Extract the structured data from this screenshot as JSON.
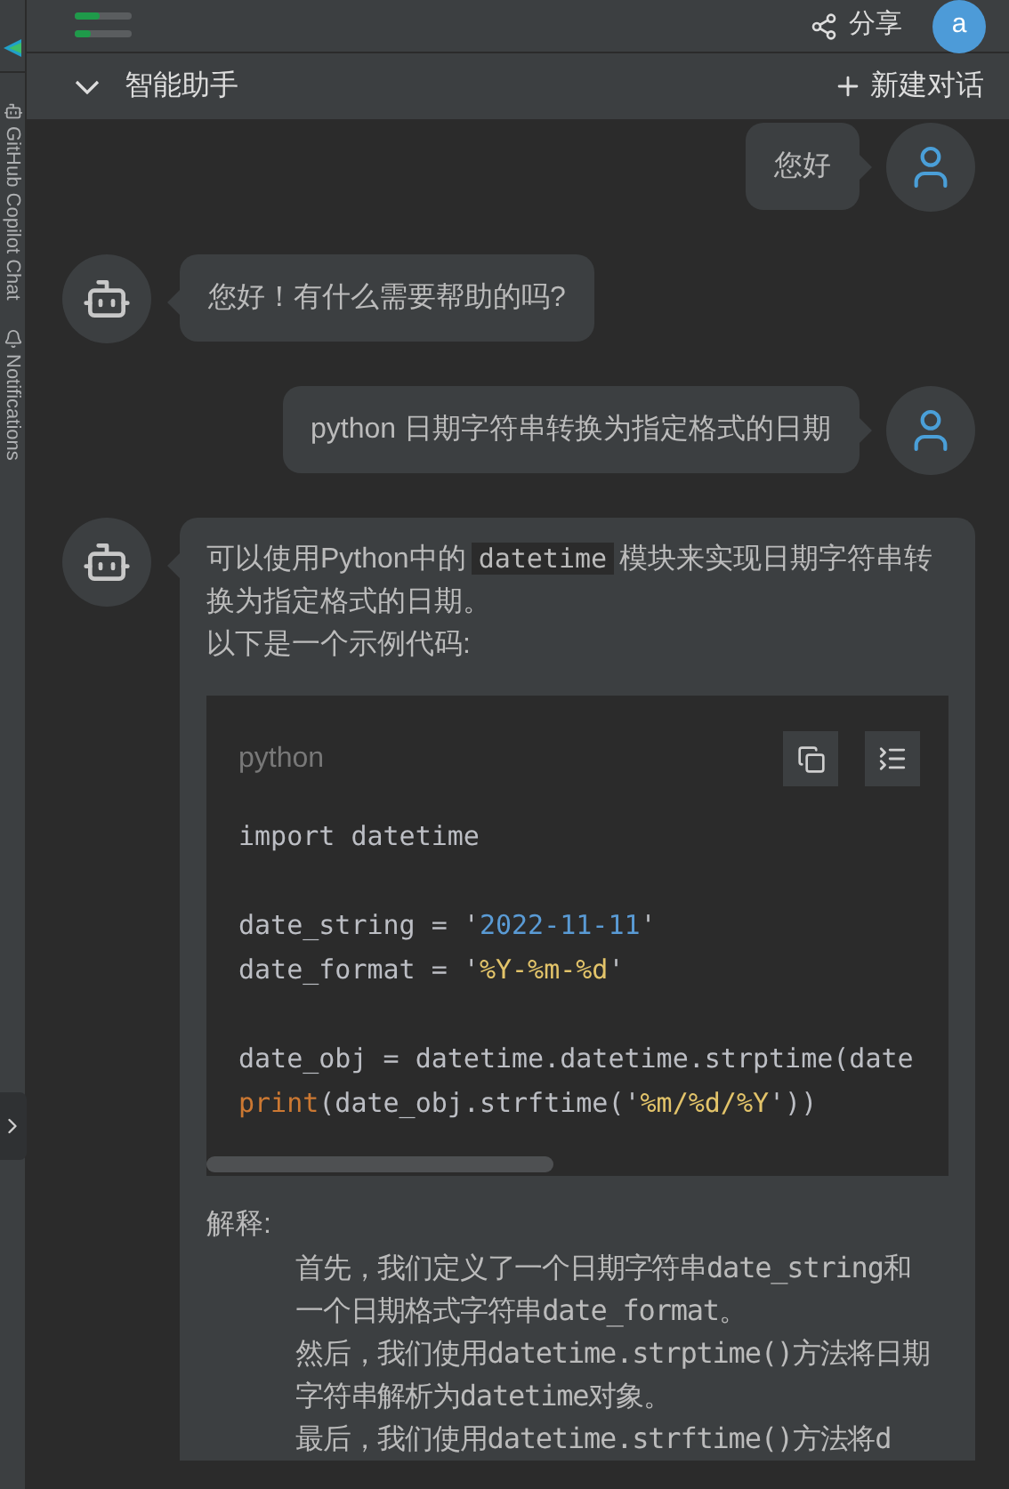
{
  "sidebar": {
    "tabs": [
      {
        "label": "GitHub Copilot Chat",
        "kind": "copilot"
      },
      {
        "label": "Notifications",
        "kind": "bell"
      }
    ]
  },
  "topbar": {
    "share": "分享",
    "avatar": "a"
  },
  "header": {
    "title": "智能助手",
    "expanded": true,
    "new_chat": "新建对话"
  },
  "messages": [
    {
      "kind": "user",
      "text": "您好"
    },
    {
      "kind": "bot",
      "text": "您好！有什么需要帮助的吗?"
    },
    {
      "kind": "user",
      "text": "python 日期字符串转换为指定格式的日期"
    },
    {
      "kind": "bot",
      "intro": [
        {
          "text": "可以使用Python中的",
          "code": false
        },
        {
          "text": "datetime",
          "code": true
        },
        {
          "text": "模块来实现日期字符串转换为指定格式的日期。",
          "code": false
        }
      ],
      "intro2": "以下是一个示例代码:",
      "code_block": {
        "language": "python",
        "groups": [
          [
            [
              {
                "text": "import datetime",
                "kind": "plain"
              }
            ]
          ],
          [
            [
              {
                "text": "date_string = '",
                "kind": "plain"
              },
              {
                "text": "2022-11-11",
                "kind": "number"
              },
              {
                "text": "'",
                "kind": "plain"
              }
            ],
            [
              {
                "text": "date_format = '",
                "kind": "plain"
              },
              {
                "text": "%Y-%m-%d",
                "kind": "format"
              },
              {
                "text": "'",
                "kind": "plain"
              }
            ]
          ],
          [
            [
              {
                "text": "date_obj = datetime.datetime.strptime(date",
                "kind": "plain"
              }
            ],
            [
              {
                "text": "print",
                "kind": "builtin"
              },
              {
                "text": "(date_obj.strftime('",
                "kind": "plain"
              },
              {
                "text": "%m/%d/%Y",
                "kind": "format"
              },
              {
                "text": "'))",
                "kind": "plain"
              }
            ]
          ]
        ]
      },
      "explanation_title": "解释:",
      "explanation": [
        "首先，我们定义了一个日期字符串date_string和一个日期格式字符串date_format。",
        "然后，我们使用datetime.strptime()方法将日期字符串解析为datetime对象。",
        "最后，我们使用datetime.strftime()方法将d"
      ]
    }
  ]
}
